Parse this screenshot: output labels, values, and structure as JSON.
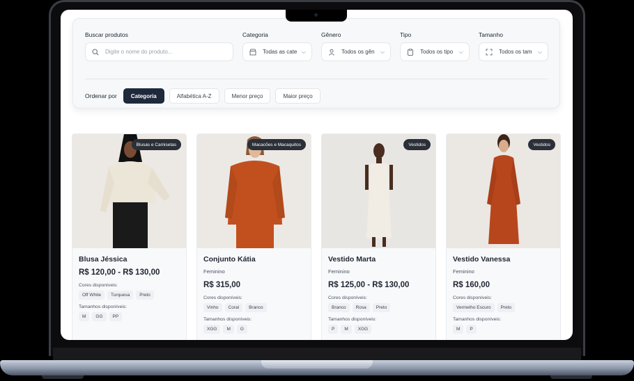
{
  "filters": {
    "search": {
      "label": "Buscar produtos",
      "placeholder": "Digite o nome do produto..."
    },
    "category": {
      "label": "Categoria",
      "value": "Todas as cate"
    },
    "gender": {
      "label": "Gênero",
      "value": "Todos os gên"
    },
    "type": {
      "label": "Tipo",
      "value": "Todos os tipo"
    },
    "size": {
      "label": "Tamanho",
      "value": "Todos os tam"
    }
  },
  "sort": {
    "label": "Ordenar por",
    "options": [
      "Categoria",
      "Alfabética A-Z",
      "Menor preço",
      "Maior preço"
    ],
    "active": "Categoria"
  },
  "colors_label": "Cores disponíveis:",
  "sizes_label": "Tamanhos disponíveis:",
  "products": [
    {
      "badge": "Blusas e Camisetas",
      "name": "Blusa Jéssica",
      "gender": "",
      "price": "R$ 120,00 - R$ 130,00",
      "colors": [
        "Off White",
        "Turquesa",
        "Preto"
      ],
      "sizes": [
        "M",
        "GG",
        "PP"
      ],
      "garment_color": "#ece6d8"
    },
    {
      "badge": "Macacões e Macaquitos",
      "name": "Conjunto Kátia",
      "gender": "Feminino",
      "price": "R$ 315,00",
      "colors": [
        "Vinho",
        "Coral",
        "Branco"
      ],
      "sizes": [
        "XGG",
        "M",
        "G"
      ],
      "garment_color": "#c2501e"
    },
    {
      "badge": "Vestidos",
      "name": "Vestido Marta",
      "gender": "Feminino",
      "price": "R$ 125,00 - R$ 130,00",
      "colors": [
        "Branco",
        "Rosa",
        "Preto"
      ],
      "sizes": [
        "P",
        "M",
        "XGG"
      ],
      "garment_color": "#f1ede4"
    },
    {
      "badge": "Vestidos",
      "name": "Vestido Vanessa",
      "gender": "Feminino",
      "price": "R$ 160,00",
      "colors": [
        "Vermelho Escuro",
        "Preto"
      ],
      "sizes": [
        "M",
        "P"
      ],
      "garment_color": "#b8461c"
    }
  ]
}
